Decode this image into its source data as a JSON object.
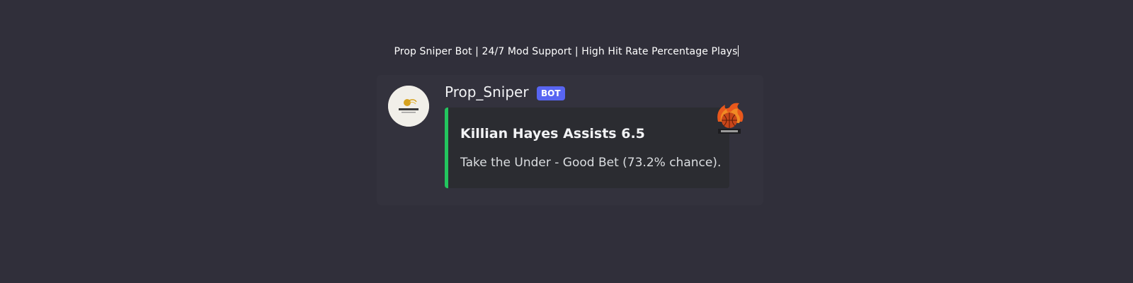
{
  "header": {
    "tagline": "Prop Sniper Bot | 24/7 Mod Support | High Hit Rate Percentage Plays"
  },
  "message": {
    "username": "Prop_Sniper",
    "badge": "BOT",
    "avatar_icon": "bet-buddy-logo-icon",
    "embed": {
      "accent_color": "#23c55e",
      "title": "Killian Hayes Assists 6.5",
      "description": "Take the Under - Good Bet (73.2% chance).",
      "thumbnail_icon": "flaming-basketball-icon"
    }
  },
  "colors": {
    "background": "#302f3a",
    "bot_badge": "#5865f2"
  }
}
